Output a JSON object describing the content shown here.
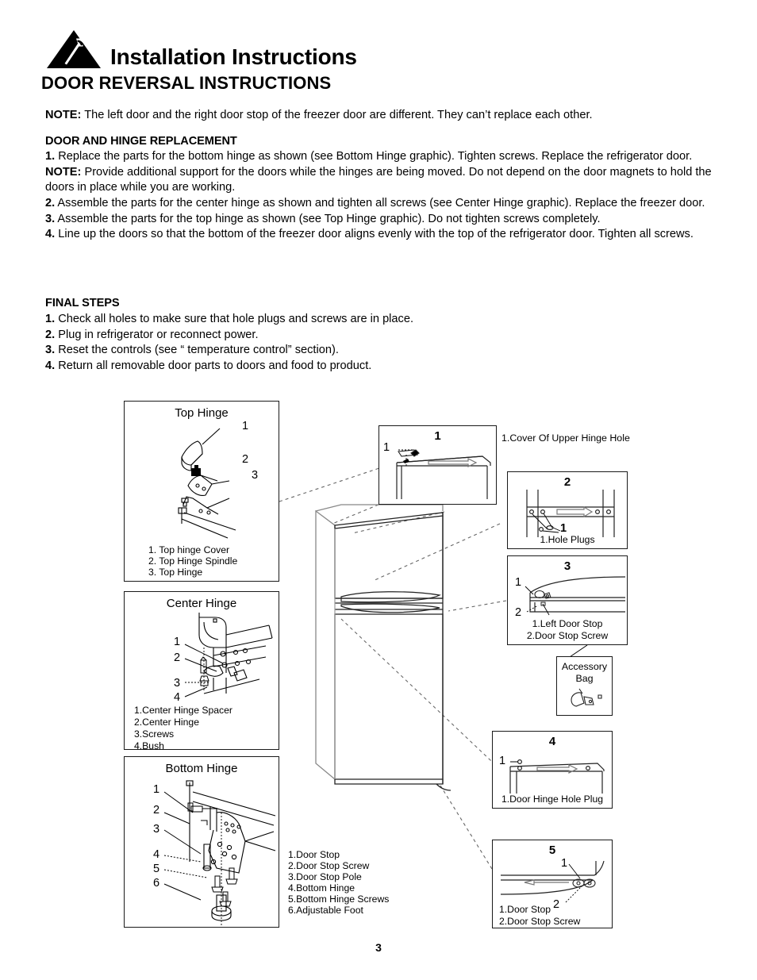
{
  "header": {
    "icon": "hammer-warning-triangle-icon",
    "title": "Installation Instructions",
    "section_title": "DOOR REVERSAL INSTRUCTIONS"
  },
  "body": {
    "note1_label": "NOTE:",
    "note1_text": " The left door and the right door stop of the freezer door are different.  They can’t replace each other.",
    "subhead": "DOOR AND HINGE REPLACEMENT",
    "step1_num": "1.",
    "step1_text": " Replace the parts for the bottom hinge as shown (see Bottom Hinge graphic). Tighten screws. Replace the refrigerator door.",
    "note2_label": "NOTE:",
    "note2_text": " Provide additional support for the doors while the hinges are being moved. Do not depend on the door magnets to hold the doors in place while you are working.",
    "step2_num": "2.",
    "step2_text": " Assemble the parts for the center hinge as shown and tighten all screws (see Center Hinge graphic). Replace the freezer door.",
    "step3_num": "3.",
    "step3_text": " Assemble the parts for the top hinge as shown (see Top Hinge graphic). Do not tighten screws completely.",
    "step4_num": "4.",
    "step4_text": " Line up the doors so that the bottom of the freezer door aligns evenly with the top of the refrigerator door. Tighten all screws."
  },
  "final_steps": {
    "heading": "FINAL STEPS",
    "items": [
      {
        "num": "1.",
        "text": " Check all holes to make sure that hole plugs and screws are in place."
      },
      {
        "num": "2.",
        "text": " Plug in refrigerator or reconnect power."
      },
      {
        "num": "3.",
        "text": " Reset the controls (see “ temperature control” section)."
      },
      {
        "num": "4.",
        "text": " Return all removable door parts to doors and food to product."
      }
    ]
  },
  "figures": {
    "top_hinge": {
      "title": "Top Hinge",
      "callouts": [
        "1",
        "2",
        "3"
      ],
      "legend": [
        "1. Top hinge Cover",
        "2. Top Hinge Spindle",
        "3. Top Hinge"
      ]
    },
    "center_hinge": {
      "title": "Center Hinge",
      "callouts": [
        "1",
        "2",
        "3",
        "4"
      ],
      "legend": [
        "1.Center Hinge Spacer",
        "2.Center Hinge",
        "3.Screws",
        "4.Bush"
      ]
    },
    "bottom_hinge": {
      "title": "Bottom Hinge",
      "callouts": [
        "1",
        "2",
        "3",
        "4",
        "5",
        "6"
      ],
      "legend": [
        "1.Door Stop",
        "2.Door Stop Screw",
        "3.Door Stop Pole",
        "4.Bottom Hinge",
        "5.Bottom Hinge Screws",
        "6.Adjustable Foot"
      ]
    },
    "detail_1": {
      "number": "1",
      "callout": "1",
      "external_legend": "1.Cover Of Upper Hinge Hole"
    },
    "detail_2": {
      "number": "2",
      "callout": "1",
      "legend": "1.Hole Plugs"
    },
    "detail_3": {
      "number": "3",
      "callouts": [
        "1",
        "2"
      ],
      "legend": [
        "1.Left Door Stop",
        "2.Door Stop Screw"
      ]
    },
    "detail_4": {
      "number": "4",
      "callout": "1",
      "legend": "1.Door Hinge Hole Plug"
    },
    "detail_5": {
      "number": "5",
      "callouts": [
        "1",
        "2"
      ],
      "legend": [
        "1.Door Stop",
        "2.Door Stop Screw"
      ]
    },
    "accessory_bag": {
      "line1": "Accessory",
      "line2": "Bag"
    },
    "refrigerator": {
      "name": "refrigerator-illustration"
    }
  },
  "page_number": "3"
}
